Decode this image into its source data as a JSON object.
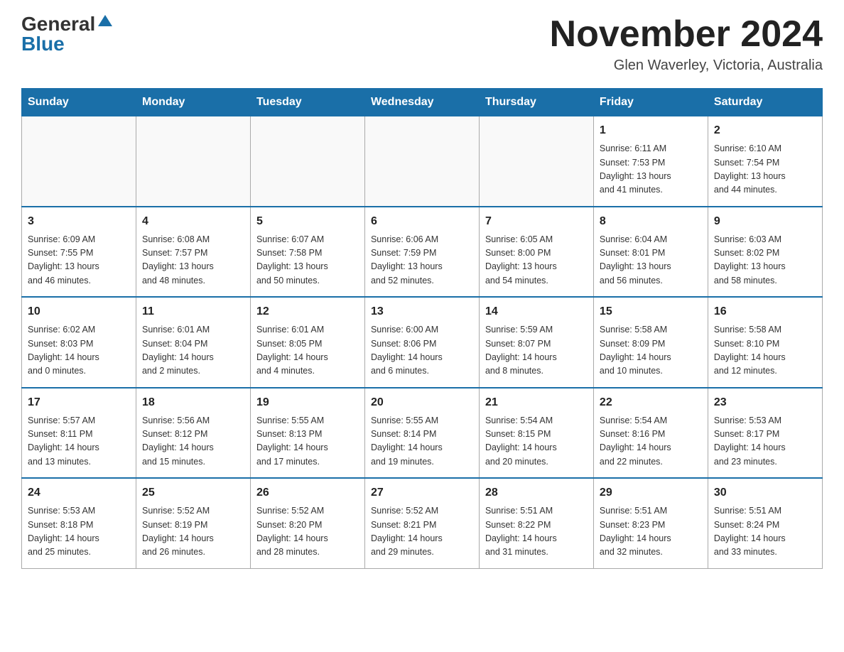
{
  "header": {
    "logo_general": "General",
    "logo_blue": "Blue",
    "month_title": "November 2024",
    "location": "Glen Waverley, Victoria, Australia"
  },
  "weekdays": [
    "Sunday",
    "Monday",
    "Tuesday",
    "Wednesday",
    "Thursday",
    "Friday",
    "Saturday"
  ],
  "weeks": [
    [
      {
        "day": "",
        "info": ""
      },
      {
        "day": "",
        "info": ""
      },
      {
        "day": "",
        "info": ""
      },
      {
        "day": "",
        "info": ""
      },
      {
        "day": "",
        "info": ""
      },
      {
        "day": "1",
        "info": "Sunrise: 6:11 AM\nSunset: 7:53 PM\nDaylight: 13 hours\nand 41 minutes."
      },
      {
        "day": "2",
        "info": "Sunrise: 6:10 AM\nSunset: 7:54 PM\nDaylight: 13 hours\nand 44 minutes."
      }
    ],
    [
      {
        "day": "3",
        "info": "Sunrise: 6:09 AM\nSunset: 7:55 PM\nDaylight: 13 hours\nand 46 minutes."
      },
      {
        "day": "4",
        "info": "Sunrise: 6:08 AM\nSunset: 7:57 PM\nDaylight: 13 hours\nand 48 minutes."
      },
      {
        "day": "5",
        "info": "Sunrise: 6:07 AM\nSunset: 7:58 PM\nDaylight: 13 hours\nand 50 minutes."
      },
      {
        "day": "6",
        "info": "Sunrise: 6:06 AM\nSunset: 7:59 PM\nDaylight: 13 hours\nand 52 minutes."
      },
      {
        "day": "7",
        "info": "Sunrise: 6:05 AM\nSunset: 8:00 PM\nDaylight: 13 hours\nand 54 minutes."
      },
      {
        "day": "8",
        "info": "Sunrise: 6:04 AM\nSunset: 8:01 PM\nDaylight: 13 hours\nand 56 minutes."
      },
      {
        "day": "9",
        "info": "Sunrise: 6:03 AM\nSunset: 8:02 PM\nDaylight: 13 hours\nand 58 minutes."
      }
    ],
    [
      {
        "day": "10",
        "info": "Sunrise: 6:02 AM\nSunset: 8:03 PM\nDaylight: 14 hours\nand 0 minutes."
      },
      {
        "day": "11",
        "info": "Sunrise: 6:01 AM\nSunset: 8:04 PM\nDaylight: 14 hours\nand 2 minutes."
      },
      {
        "day": "12",
        "info": "Sunrise: 6:01 AM\nSunset: 8:05 PM\nDaylight: 14 hours\nand 4 minutes."
      },
      {
        "day": "13",
        "info": "Sunrise: 6:00 AM\nSunset: 8:06 PM\nDaylight: 14 hours\nand 6 minutes."
      },
      {
        "day": "14",
        "info": "Sunrise: 5:59 AM\nSunset: 8:07 PM\nDaylight: 14 hours\nand 8 minutes."
      },
      {
        "day": "15",
        "info": "Sunrise: 5:58 AM\nSunset: 8:09 PM\nDaylight: 14 hours\nand 10 minutes."
      },
      {
        "day": "16",
        "info": "Sunrise: 5:58 AM\nSunset: 8:10 PM\nDaylight: 14 hours\nand 12 minutes."
      }
    ],
    [
      {
        "day": "17",
        "info": "Sunrise: 5:57 AM\nSunset: 8:11 PM\nDaylight: 14 hours\nand 13 minutes."
      },
      {
        "day": "18",
        "info": "Sunrise: 5:56 AM\nSunset: 8:12 PM\nDaylight: 14 hours\nand 15 minutes."
      },
      {
        "day": "19",
        "info": "Sunrise: 5:55 AM\nSunset: 8:13 PM\nDaylight: 14 hours\nand 17 minutes."
      },
      {
        "day": "20",
        "info": "Sunrise: 5:55 AM\nSunset: 8:14 PM\nDaylight: 14 hours\nand 19 minutes."
      },
      {
        "day": "21",
        "info": "Sunrise: 5:54 AM\nSunset: 8:15 PM\nDaylight: 14 hours\nand 20 minutes."
      },
      {
        "day": "22",
        "info": "Sunrise: 5:54 AM\nSunset: 8:16 PM\nDaylight: 14 hours\nand 22 minutes."
      },
      {
        "day": "23",
        "info": "Sunrise: 5:53 AM\nSunset: 8:17 PM\nDaylight: 14 hours\nand 23 minutes."
      }
    ],
    [
      {
        "day": "24",
        "info": "Sunrise: 5:53 AM\nSunset: 8:18 PM\nDaylight: 14 hours\nand 25 minutes."
      },
      {
        "day": "25",
        "info": "Sunrise: 5:52 AM\nSunset: 8:19 PM\nDaylight: 14 hours\nand 26 minutes."
      },
      {
        "day": "26",
        "info": "Sunrise: 5:52 AM\nSunset: 8:20 PM\nDaylight: 14 hours\nand 28 minutes."
      },
      {
        "day": "27",
        "info": "Sunrise: 5:52 AM\nSunset: 8:21 PM\nDaylight: 14 hours\nand 29 minutes."
      },
      {
        "day": "28",
        "info": "Sunrise: 5:51 AM\nSunset: 8:22 PM\nDaylight: 14 hours\nand 31 minutes."
      },
      {
        "day": "29",
        "info": "Sunrise: 5:51 AM\nSunset: 8:23 PM\nDaylight: 14 hours\nand 32 minutes."
      },
      {
        "day": "30",
        "info": "Sunrise: 5:51 AM\nSunset: 8:24 PM\nDaylight: 14 hours\nand 33 minutes."
      }
    ]
  ]
}
